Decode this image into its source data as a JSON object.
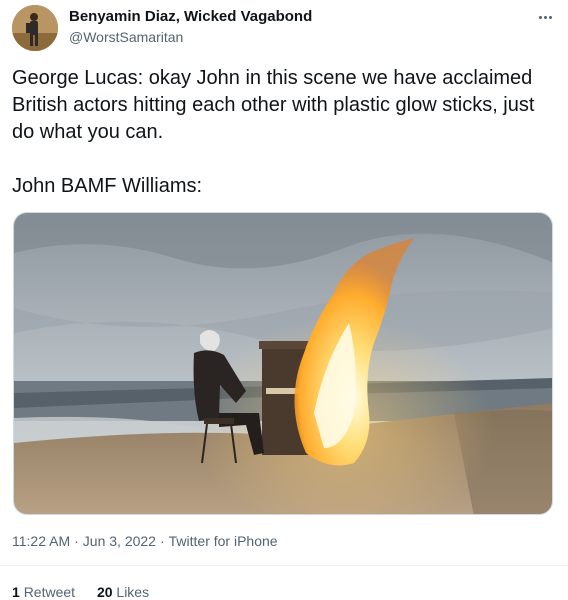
{
  "author": {
    "display_name": "Benyamin Diaz, Wicked Vagabond",
    "handle": "@WorstSamaritan"
  },
  "tweet": {
    "text": "George Lucas: okay John in this scene we have acclaimed British actors hitting each other with plastic glow sticks, just do what you can.\n\nJohn BAMF Williams:"
  },
  "meta": {
    "time": "11:22 AM",
    "date": "Jun 3, 2022",
    "source": "Twitter for iPhone",
    "separator": "·"
  },
  "stats": {
    "retweet_count": "1",
    "retweet_label": "Retweet",
    "likes_count": "20",
    "likes_label": "Likes"
  },
  "icons": {
    "more": "more-horizontal-icon"
  }
}
